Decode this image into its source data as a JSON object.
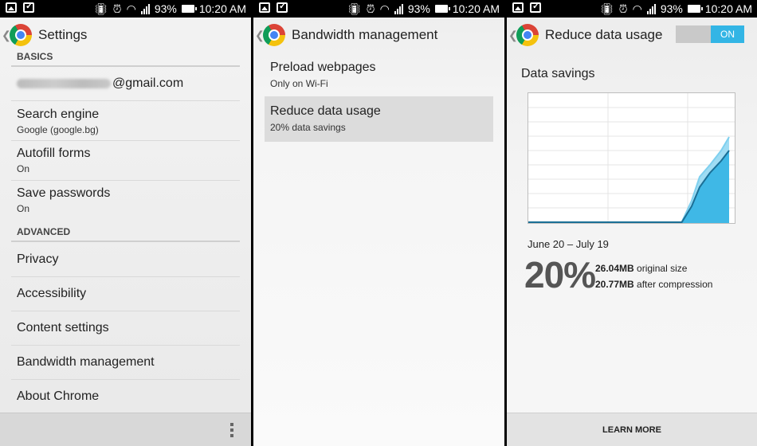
{
  "status_bar": {
    "battery": "93%",
    "time": "10:20 AM"
  },
  "panel1": {
    "title": "Settings",
    "sections": {
      "basics": "BASICS",
      "advanced": "ADVANCED"
    },
    "account": {
      "email_suffix": "@gmail.com"
    },
    "basics_items": [
      {
        "title": "Search engine",
        "subtitle": "Google (google.bg)"
      },
      {
        "title": "Autofill forms",
        "subtitle": "On"
      },
      {
        "title": "Save passwords",
        "subtitle": "On"
      }
    ],
    "advanced_items": [
      {
        "title": "Privacy"
      },
      {
        "title": "Accessibility"
      },
      {
        "title": "Content settings"
      },
      {
        "title": "Bandwidth management"
      },
      {
        "title": "About Chrome"
      }
    ]
  },
  "panel2": {
    "title": "Bandwidth management",
    "items": [
      {
        "title": "Preload webpages",
        "subtitle": "Only on Wi-Fi",
        "selected": false
      },
      {
        "title": "Reduce data usage",
        "subtitle": "20% data savings",
        "selected": true
      }
    ]
  },
  "panel3": {
    "title": "Reduce data usage",
    "toggle_label": "ON",
    "section_title": "Data savings",
    "period": "June 20 – July 19",
    "percent": "20%",
    "original": {
      "value": "26.04MB",
      "label": "original size"
    },
    "compressed": {
      "value": "20.77MB",
      "label": "after compression"
    },
    "learn_more": "LEARN MORE",
    "colors": {
      "accent": "#33b5e5",
      "fill": "#3fb8e6",
      "line_dark": "#1a6f96",
      "line_light": "#7fd0ef"
    }
  }
}
